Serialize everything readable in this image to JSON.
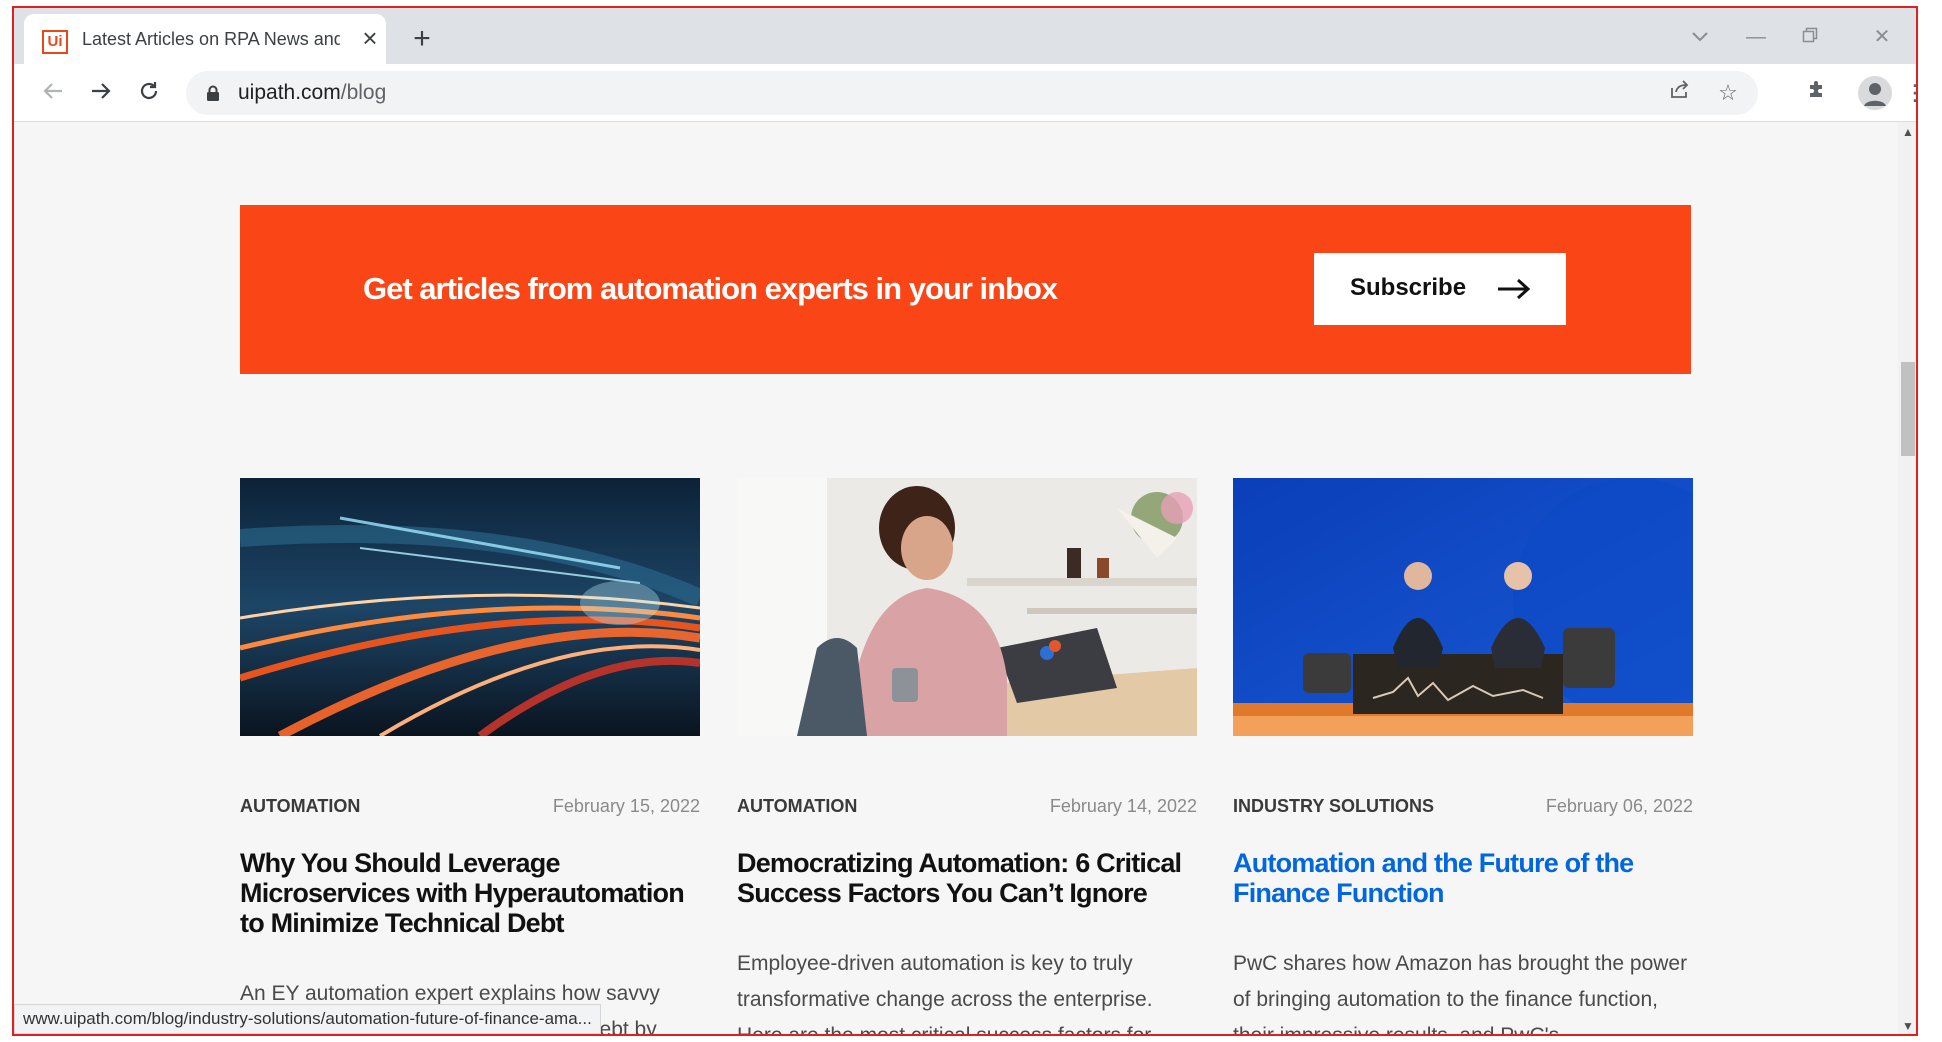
{
  "browser": {
    "tab_title": "Latest Articles on RPA News and",
    "tab_favicon_text": "Ui",
    "url_domain": "uipath.com",
    "url_path": "/blog",
    "status_url": "www.uipath.com/blog/industry-solutions/automation-future-of-finance-ama..."
  },
  "banner": {
    "text": "Get articles from automation experts in your inbox",
    "button_label": "Subscribe",
    "bg_color": "#fa4616"
  },
  "articles": [
    {
      "category": "AUTOMATION",
      "date": "February 15, 2022",
      "title": "Why You Should Leverage Microservices with Hyperautomation to Minimize Technical Debt",
      "excerpt": "An EY automation expert explains how savvy organizations can minimize technical debt by",
      "image": "light-trails-tunnel"
    },
    {
      "category": "AUTOMATION",
      "date": "February 14, 2022",
      "title": "Democratizing Automation: 6 Critical Success Factors You Can’t Ignore",
      "excerpt": "Employee-driven automation is key to truly transformative change across the enterprise. Here are the most critical success factors for",
      "image": "woman-at-laptop"
    },
    {
      "category": "INDUSTRY SOLUTIONS",
      "date": "February 06, 2022",
      "title": "Automation and the Future of the Finance Function",
      "excerpt": "PwC shares how Amazon has brought the power of bringing automation to the finance function, their impressive results, and PwC's",
      "image": "stage-interview",
      "hovered": true
    }
  ],
  "colors": {
    "accent": "#fa4616",
    "link_hover": "#0067df"
  }
}
